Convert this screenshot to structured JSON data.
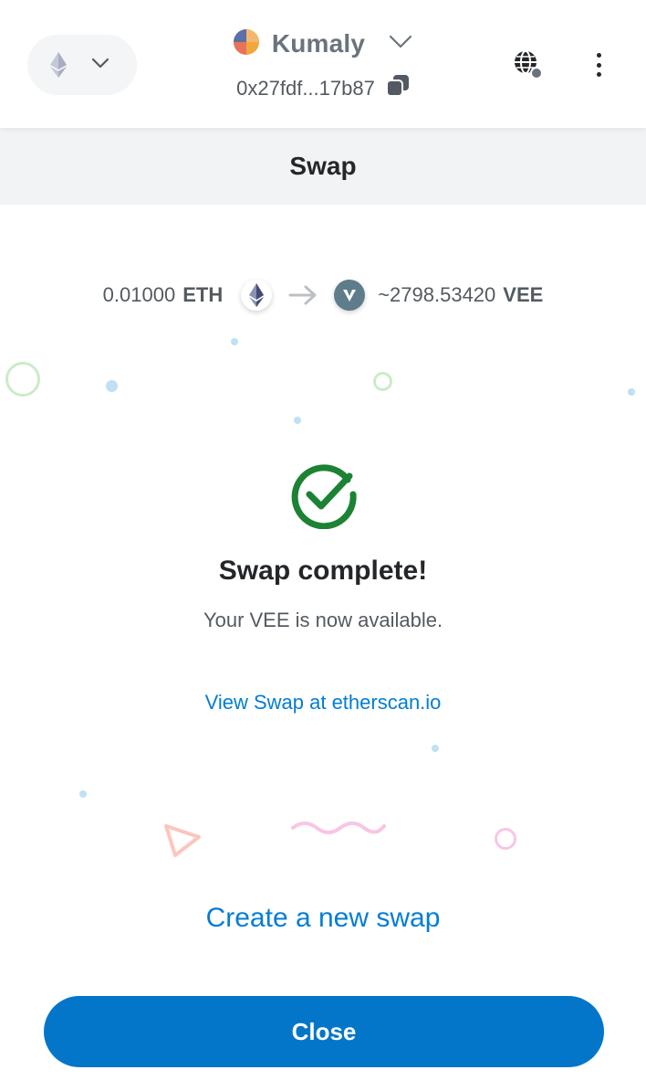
{
  "header": {
    "account_name": "Kumaly",
    "address": "0x27fdf...17b87",
    "network_icon": "ethereum-icon",
    "colors": {
      "header_bg": "#ffffff",
      "pill_bg": "#f4f5f6"
    }
  },
  "page": {
    "title": "Swap"
  },
  "summary": {
    "from_amount": "0.01000",
    "from_symbol": "ETH",
    "to_amount": "~2798.53420",
    "to_symbol": "VEE"
  },
  "result": {
    "title": "Swap complete!",
    "subtitle": "Your VEE is now available.",
    "view_link": "View Swap at etherscan.io",
    "new_swap_link": "Create a new swap",
    "close_label": "Close"
  },
  "colors": {
    "primary": "#0376c9",
    "link": "#037dd6",
    "success": "#1c8234",
    "titlebar_bg": "#f2f3f4"
  }
}
